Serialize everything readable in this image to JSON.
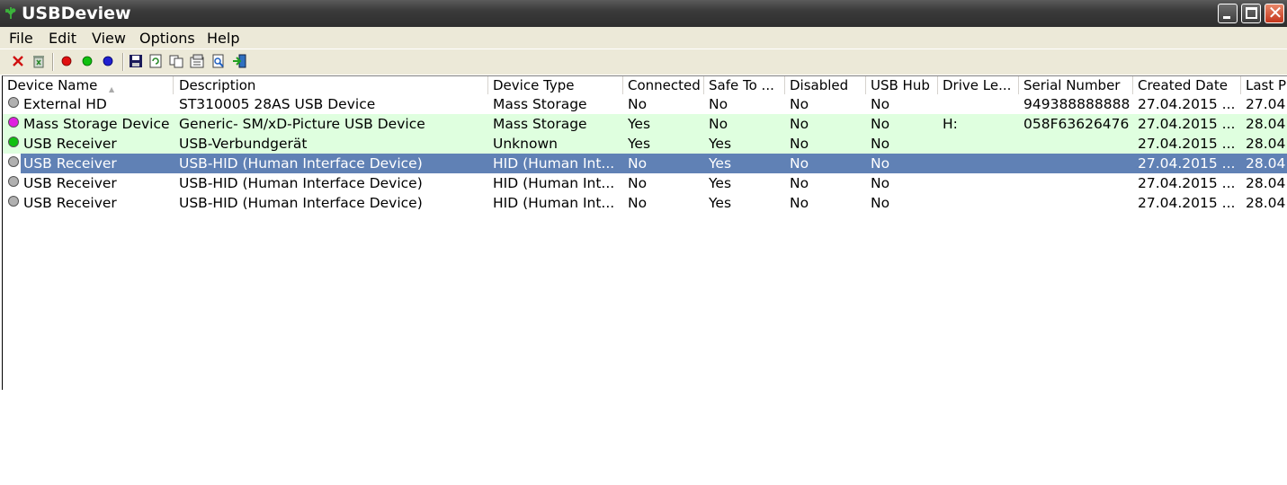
{
  "window": {
    "title": "USBDeview"
  },
  "menu": [
    "File",
    "Edit",
    "View",
    "Options",
    "Help"
  ],
  "toolbar": {
    "icons": [
      "delete-icon",
      "uninstall-icon",
      "disconnect-red-icon",
      "connect-green-icon",
      "blue-dot-icon",
      "save-icon",
      "refresh-icon",
      "copy-icon",
      "properties-icon",
      "find-icon",
      "exit-icon"
    ]
  },
  "columns": [
    "Device Name",
    "Description",
    "Device Type",
    "Connected",
    "Safe To ...",
    "Disabled",
    "USB Hub",
    "Drive Le...",
    "Serial Number",
    "Created Date",
    "Last P"
  ],
  "rows": [
    {
      "status": "gray",
      "cells": [
        "External HD",
        "ST310005 28AS USB Device",
        "Mass Storage",
        "No",
        "No",
        "No",
        "No",
        "",
        "949388888888",
        "27.04.2015 ...",
        "27.04."
      ]
    },
    {
      "status": "magenta",
      "cells": [
        "Mass Storage Device",
        "Generic- SM/xD-Picture USB Device",
        "Mass Storage",
        "Yes",
        "No",
        "No",
        "No",
        "H:",
        "058F63626476",
        "27.04.2015 ...",
        "28.04."
      ]
    },
    {
      "status": "green",
      "cells": [
        "USB Receiver",
        "USB-Verbundgerät",
        "Unknown",
        "Yes",
        "Yes",
        "No",
        "No",
        "",
        "",
        "27.04.2015 ...",
        "28.04."
      ]
    },
    {
      "status": "gray",
      "cells": [
        "USB Receiver",
        "USB-HID (Human Interface Device)",
        "HID (Human Int...",
        "No",
        "Yes",
        "No",
        "No",
        "",
        "",
        "27.04.2015 ...",
        "28.04."
      ]
    },
    {
      "status": "gray",
      "cells": [
        "USB Receiver",
        "USB-HID (Human Interface Device)",
        "HID (Human Int...",
        "No",
        "Yes",
        "No",
        "No",
        "",
        "",
        "27.04.2015 ...",
        "28.04."
      ]
    },
    {
      "status": "gray",
      "cells": [
        "USB Receiver",
        "USB-HID (Human Interface Device)",
        "HID (Human Int...",
        "No",
        "Yes",
        "No",
        "No",
        "",
        "",
        "27.04.2015 ...",
        "28.04."
      ]
    }
  ],
  "row_states": [
    "normal",
    "green",
    "green",
    "selected",
    "normal",
    "normal"
  ],
  "status_colors": {
    "gray": "#b0b0b0",
    "magenta": "#e020e0",
    "green": "#10c010",
    "blue": "#2020d0",
    "red": "#e01010"
  },
  "accent": {
    "selection": "#6081b5",
    "connected_row": "#dfffdf"
  }
}
